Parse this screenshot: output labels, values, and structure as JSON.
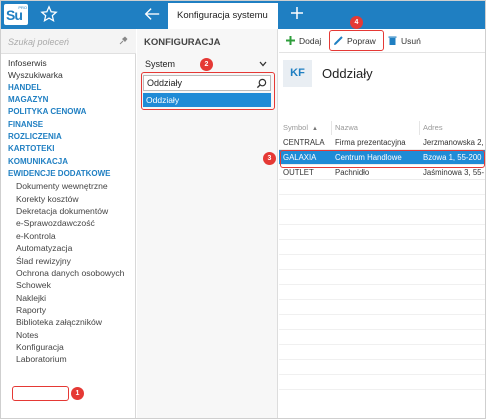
{
  "topbar": {
    "logo_text": "Su",
    "logo_sup": "PRO",
    "active_tab": "Konfiguracja systemu",
    "colors": {
      "bar": "#1f7fc2"
    },
    "icons": [
      "star-icon",
      "back-arrow-icon",
      "plus-icon"
    ]
  },
  "sidebar": {
    "search_placeholder": "Szukaj poleceń",
    "items": [
      {
        "label": "Infoserwis",
        "type": "item"
      },
      {
        "label": "Wyszukiwarka",
        "type": "item"
      },
      {
        "label": "HANDEL",
        "type": "section"
      },
      {
        "label": "MAGAZYN",
        "type": "section"
      },
      {
        "label": "POLITYKA CENOWA",
        "type": "section"
      },
      {
        "label": "FINANSE",
        "type": "section"
      },
      {
        "label": "ROZLICZENIA",
        "type": "section"
      },
      {
        "label": "KARTOTEKI",
        "type": "section"
      },
      {
        "label": "KOMUNIKACJA",
        "type": "section"
      },
      {
        "label": "EWIDENCJE DODATKOWE",
        "type": "section"
      },
      {
        "label": "Dokumenty wewnętrzne",
        "type": "sub"
      },
      {
        "label": "Korekty kosztów",
        "type": "sub"
      },
      {
        "label": "Dekretacja dokumentów",
        "type": "sub"
      },
      {
        "label": "e-Sprawozdawczość",
        "type": "sub"
      },
      {
        "label": "e-Kontrola",
        "type": "sub"
      },
      {
        "label": "Automatyzacja",
        "type": "sub"
      },
      {
        "label": "Ślad rewizyjny",
        "type": "sub"
      },
      {
        "label": "Ochrona danych osobowych",
        "type": "sub"
      },
      {
        "label": "Schowek",
        "type": "sub"
      },
      {
        "label": "Naklejki",
        "type": "sub"
      },
      {
        "label": "Raporty",
        "type": "sub"
      },
      {
        "label": "Biblioteka załączników",
        "type": "sub"
      },
      {
        "label": "Notes",
        "type": "sub"
      },
      {
        "label": "Konfiguracja",
        "type": "sub"
      },
      {
        "label": "Laboratorium",
        "type": "sub"
      }
    ]
  },
  "config_panel": {
    "title": "KONFIGURACJA",
    "dropdown_value": "System",
    "filter_value": "Oddziały",
    "result_item": "Oddziały"
  },
  "toolbar": {
    "add_label": "Dodaj",
    "edit_label": "Popraw",
    "delete_label": "Usuń"
  },
  "main": {
    "icon_text": "KF",
    "title": "Oddziały",
    "columns": [
      "Symbol",
      "Nazwa",
      "Adres"
    ],
    "rows": [
      [
        "CENTRALA",
        "Firma prezentacyjna",
        "Jerzmanowska 2,"
      ],
      [
        "GALAXIA",
        "Centrum Handlowe",
        "Bzowa 1, 55-200"
      ],
      [
        "OUTLET",
        "Pachnidło",
        "Jaśminowa 3, 55-"
      ]
    ],
    "selected_row": 1
  },
  "annotations": [
    "1",
    "2",
    "3",
    "4"
  ],
  "colors": {
    "accent": "#1f8bd6",
    "highlight": "#e53935",
    "add_green": "#2e9e3b",
    "delete_blue": "#1f7fc2"
  }
}
